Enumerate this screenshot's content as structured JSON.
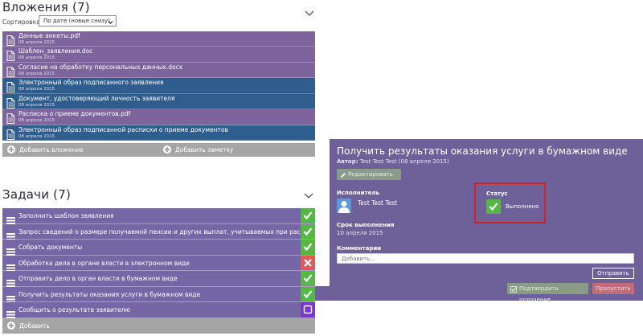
{
  "attachments": {
    "title": "Вложения (7)",
    "sort_label": "Сортировка:",
    "sort_value": "По дате (новые снизу)",
    "items": [
      {
        "name": "Данные анкеты.pdf",
        "date": "08 апреля 2015",
        "color": "purple"
      },
      {
        "name": "Шаблон_заявления.doc",
        "date": "08 апреля 2015",
        "color": "purple"
      },
      {
        "name": "Согласие на обработку персональных данных.docx",
        "date": "08 апреля 2015",
        "color": "purple"
      },
      {
        "name": "Электронный образ подписанного заявления",
        "date": "08 апреля 2015",
        "color": "blue"
      },
      {
        "name": "Документ, удостоверяющий личность заявителя",
        "date": "08 апреля 2015",
        "color": "blue"
      },
      {
        "name": "Расписка о приеме документов.pdf",
        "date": "08 апреля 2015",
        "color": "purple"
      },
      {
        "name": "Электронный образ подписанной расписки о приеме документов",
        "date": "08 апреля 2015",
        "color": "blue"
      }
    ],
    "add_attachment": "Добавить вложение",
    "add_note": "Добавить заметку"
  },
  "tasks": {
    "title": "Задачи (7)",
    "items": [
      {
        "label": "Заполнить шаблон заявления",
        "status": "done"
      },
      {
        "label": "Запрос сведений о размере получаемой пенсии и других выплат, учитываемых при расчете совокупно...",
        "status": "done"
      },
      {
        "label": "Собрать документы",
        "status": "done"
      },
      {
        "label": "Обработка дела в органе власти в электронном виде",
        "status": "failed"
      },
      {
        "label": "Отправить дело в орган власти в бумажном виде",
        "status": "done"
      },
      {
        "label": "Получить результаты оказания услуги в бумажном виде",
        "status": "done"
      },
      {
        "label": "Сообщить о результате заявителю",
        "status": "pending"
      }
    ],
    "add": "Добавить"
  },
  "detail": {
    "title": "Получить результаты оказания услуги в бумажном виде",
    "author_label": "Автор:",
    "author_value": "Test Test Test (08 апреля 2015)",
    "edit_button": "Редактировать",
    "executor_label": "Исполнитель",
    "executor_name": "Test Test Test",
    "status_label": "Статус",
    "status_value": "Выполнено",
    "due_label": "Срок выполнения",
    "due_value": "10 апреля 2015",
    "comments_label": "Комментарии",
    "comment_placeholder": "Добавить...",
    "send_button": "Отправить",
    "confirm_button": "Подтвердить получение",
    "skip_button": "Пропустить"
  },
  "colors": {
    "purple_row": "#7d649c",
    "blue_row": "#2f5e8e",
    "task_row": "#7566a6",
    "done": "#55b845",
    "failed": "#e05a5a",
    "pending": "#7a38c8",
    "panel": "#6e6098",
    "highlight": "#d62020"
  }
}
